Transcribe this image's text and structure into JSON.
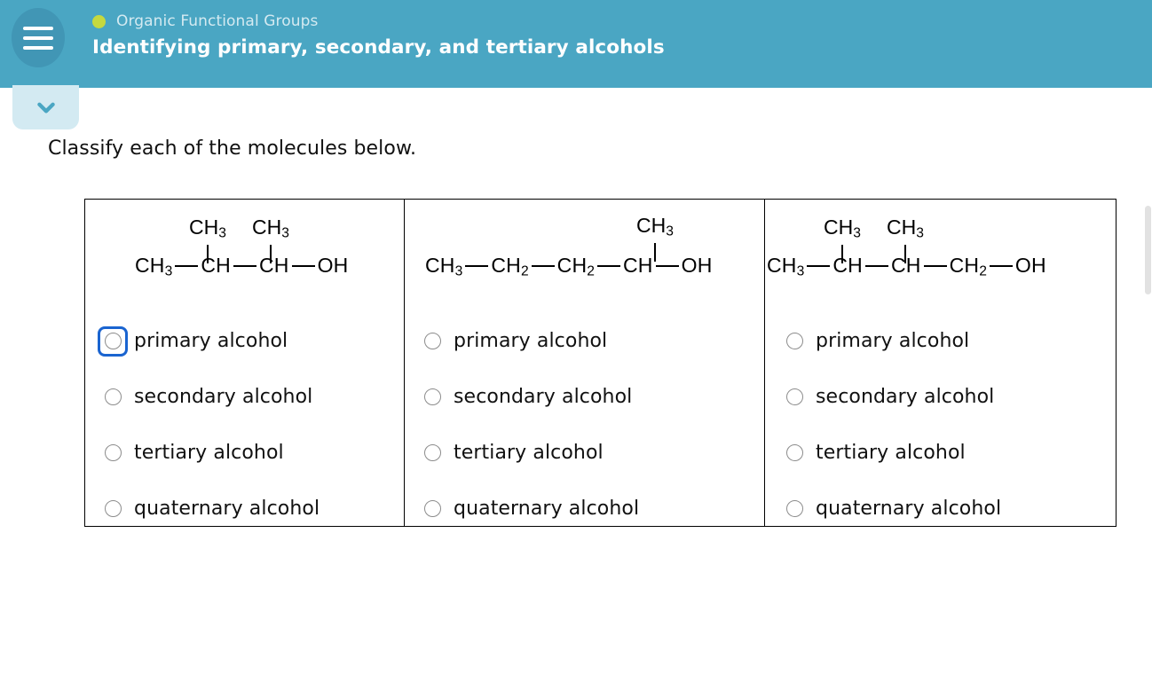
{
  "header": {
    "menu_icon": "hamburger-icon",
    "course_dot_color": "#c5d93f",
    "course_name": "Organic Functional Groups",
    "assignment_title": "Identifying primary, secondary, and tertiary alcohols",
    "background_color": "#4aa6c3"
  },
  "collapse_tab": {
    "icon": "chevron-down-icon",
    "background_color": "#d3eaf2",
    "icon_color": "#4aa6c3"
  },
  "content": {
    "prompt": "Classify each of the molecules below."
  },
  "focus_color": "#1a64d0",
  "columns": [
    {
      "id": "molecule-1",
      "formula": {
        "backbone": [
          {
            "label": "CH",
            "sub": "3"
          },
          {
            "bond": true
          },
          {
            "label": "CH",
            "sub": ""
          },
          {
            "bond": true
          },
          {
            "label": "CH",
            "sub": ""
          },
          {
            "bond": true
          },
          {
            "label": "OH",
            "sub": ""
          }
        ],
        "branches": [
          {
            "label": "CH",
            "sub": "3"
          },
          {
            "label": "CH",
            "sub": "3"
          }
        ],
        "text": "CH3-CH(CH3)-CH(CH3)-OH"
      },
      "options": [
        {
          "label": "primary alcohol",
          "selected": false,
          "focused": true
        },
        {
          "label": "secondary alcohol",
          "selected": false,
          "focused": false
        },
        {
          "label": "tertiary alcohol",
          "selected": false,
          "focused": false
        },
        {
          "label": "quaternary alcohol",
          "selected": false,
          "focused": false
        }
      ]
    },
    {
      "id": "molecule-2",
      "formula": {
        "backbone": [
          {
            "label": "CH",
            "sub": "3"
          },
          {
            "bond": true
          },
          {
            "label": "CH",
            "sub": "2"
          },
          {
            "bond": true
          },
          {
            "label": "CH",
            "sub": "2"
          },
          {
            "bond": true
          },
          {
            "label": "CH",
            "sub": ""
          },
          {
            "bond": true
          },
          {
            "label": "OH",
            "sub": ""
          }
        ],
        "branches": [
          {
            "label": "CH",
            "sub": "3"
          }
        ],
        "text": "CH3-CH2-CH2-CH(CH3)-OH"
      },
      "options": [
        {
          "label": "primary alcohol",
          "selected": false,
          "focused": false
        },
        {
          "label": "secondary alcohol",
          "selected": false,
          "focused": false
        },
        {
          "label": "tertiary alcohol",
          "selected": false,
          "focused": false
        },
        {
          "label": "quaternary alcohol",
          "selected": false,
          "focused": false
        }
      ]
    },
    {
      "id": "molecule-3",
      "formula": {
        "backbone": [
          {
            "label": "CH",
            "sub": "3"
          },
          {
            "bond": true
          },
          {
            "label": "CH",
            "sub": ""
          },
          {
            "bond": true
          },
          {
            "label": "CH",
            "sub": ""
          },
          {
            "bond": true
          },
          {
            "label": "CH",
            "sub": "2"
          },
          {
            "bond": true
          },
          {
            "label": "OH",
            "sub": ""
          }
        ],
        "branches": [
          {
            "label": "CH",
            "sub": "3"
          },
          {
            "label": "CH",
            "sub": "3"
          }
        ],
        "text": "CH3-CH(CH3)-CH(CH3)-CH2-OH"
      },
      "options": [
        {
          "label": "primary alcohol",
          "selected": false,
          "focused": false
        },
        {
          "label": "secondary alcohol",
          "selected": false,
          "focused": false
        },
        {
          "label": "tertiary alcohol",
          "selected": false,
          "focused": false
        },
        {
          "label": "quaternary alcohol",
          "selected": false,
          "focused": false
        }
      ]
    }
  ]
}
